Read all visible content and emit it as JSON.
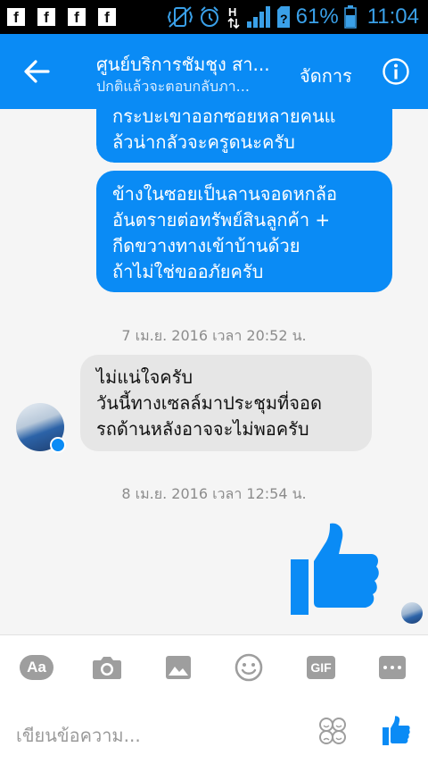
{
  "status_bar": {
    "battery": "61%",
    "time": "11:04",
    "network": "H",
    "notifications": [
      "facebook-icon",
      "facebook-icon",
      "facebook-icon",
      "facebook-icon"
    ]
  },
  "header": {
    "title": "ศูนย์บริการชัมชุง สา...",
    "subtitle": "ปกติแล้วจะตอบกลับภา...",
    "manage_label": "จัดการ"
  },
  "messages": [
    {
      "type": "outgoing",
      "lines": [
        "กระบะเขาออกซอยหลายคนแ",
        "ล้วน่ากลัวจะครูดนะครับ"
      ]
    },
    {
      "type": "outgoing",
      "lines": [
        "ข้างในซอยเป็นลานจอดหกล้อ",
        "อันตรายต่อทรัพย์สินลูกค้า +",
        "กีดขวางทางเข้าบ้านด้วย",
        "ถ้าไม่ใช่ขออภัยครับ"
      ]
    },
    {
      "type": "timestamp",
      "text": "7 เม.ย. 2016 เวลา 20:52 น."
    },
    {
      "type": "incoming",
      "lines": [
        "ไม่แน่ใจครับ",
        "วันนี้ทางเซลล์มาประชุมที่จอด",
        "รถด้านหลังอาจจะไม่พอครับ"
      ]
    },
    {
      "type": "timestamp",
      "text": "8 เม.ย. 2016 เวลา 12:54 น."
    },
    {
      "type": "outgoing-sticker",
      "icon": "thumbs-up-icon"
    }
  ],
  "toolbar": {
    "aa_label": "Aa",
    "gif_label": "GIF",
    "compose_placeholder": "เขียนข้อความ..."
  },
  "colors": {
    "accent": "#0a8bf5",
    "incoming_bubble": "#e6e6e6",
    "status_bar": "#000000",
    "status_text": "#3aa0e8"
  }
}
